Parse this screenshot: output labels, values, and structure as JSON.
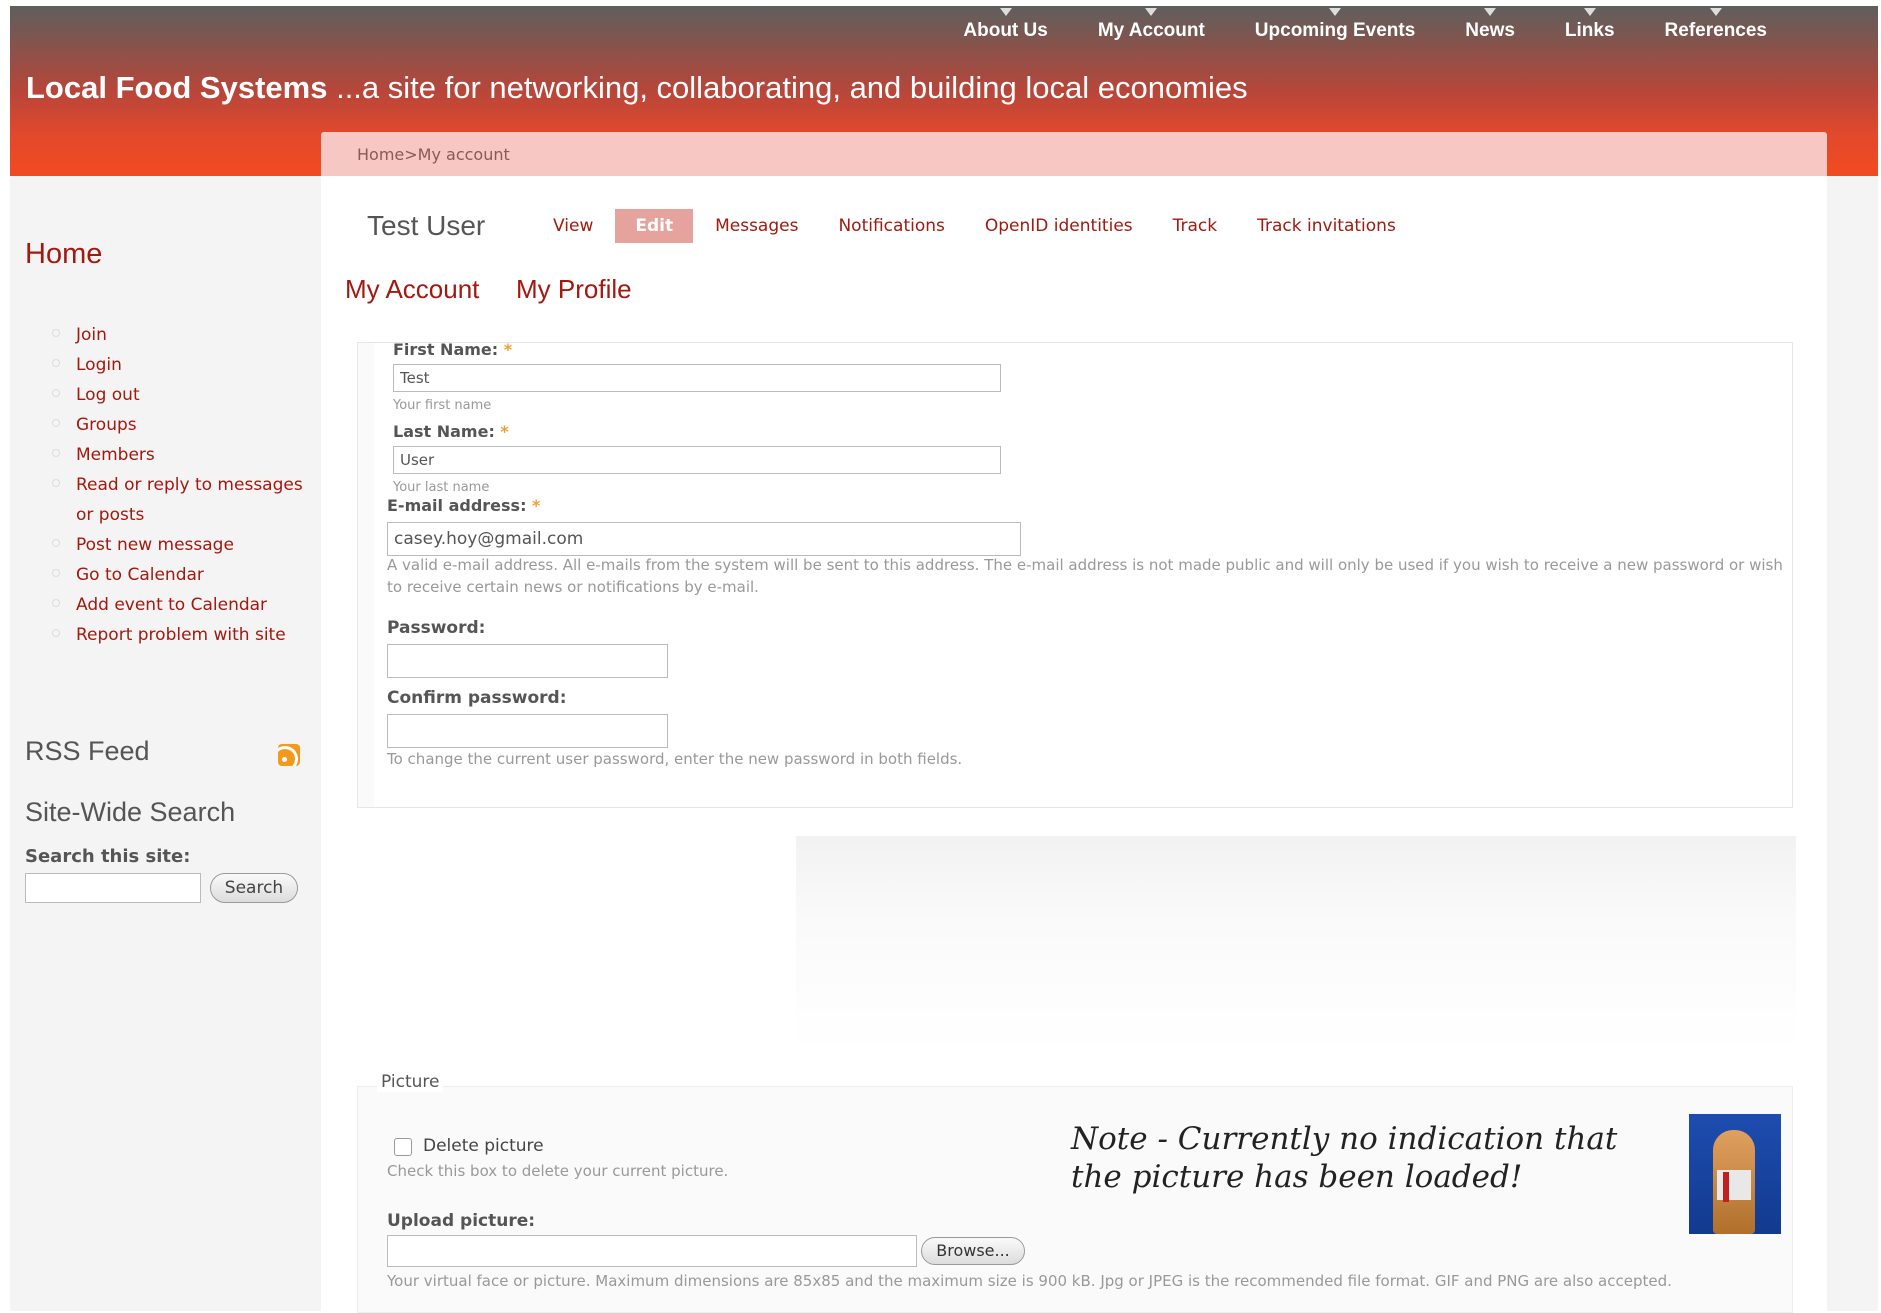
{
  "header": {
    "nav": [
      "About Us",
      "My Account",
      "Upcoming Events",
      "News",
      "Links",
      "References"
    ],
    "site_name": "Local Food Systems",
    "tagline": " ...a site for networking, collaborating, and building local economies"
  },
  "breadcrumb": "Home>My account",
  "sidebar": {
    "home": "Home",
    "items": [
      "Join",
      "Login",
      "Log out",
      "Groups",
      "Members",
      "Read or reply to messages or posts",
      "Post new message",
      "Go to Calendar",
      "Add event to Calendar",
      "Report problem with site"
    ],
    "rss": "RSS Feed",
    "search_heading": "Site-Wide Search",
    "search_label": "Search this site:",
    "search_button": "Search"
  },
  "main": {
    "user": "Test User",
    "tabs": [
      "View",
      "Edit",
      "Messages",
      "Notifications",
      "OpenID identities",
      "Track",
      "Track invitations"
    ],
    "subtabs": [
      "My Account",
      "My Profile"
    ],
    "first_name": {
      "label": "First Name:",
      "value": "Test",
      "desc": "Your first name"
    },
    "last_name": {
      "label": "Last Name:",
      "value": "User",
      "desc": "Your last name"
    },
    "email": {
      "label": "E-mail address:",
      "value": "casey.hoy@gmail.com",
      "desc": "A valid e-mail address. All e-mails from the system will be sent to this address. The e-mail address is not made public and will only be used if you wish to receive a new password or wish to receive certain news or notifications by e-mail."
    },
    "password": {
      "label": "Password:"
    },
    "confirm": {
      "label": "Confirm password:",
      "desc": "To change the current user password, enter the new password in both fields."
    },
    "required_mark": "*",
    "picture": {
      "legend": "Picture",
      "delete_label": "Delete picture",
      "delete_desc": "Check this box to delete your current picture.",
      "upload_label": "Upload picture:",
      "browse": "Browse...",
      "upload_desc": "Your virtual face or picture. Maximum dimensions are 85x85 and the maximum size is 900 kB. Jpg or JPEG is the recommended file format. GIF and PNG are also accepted."
    },
    "note": "Note - Currently no indication that the picture has been loaded!"
  }
}
